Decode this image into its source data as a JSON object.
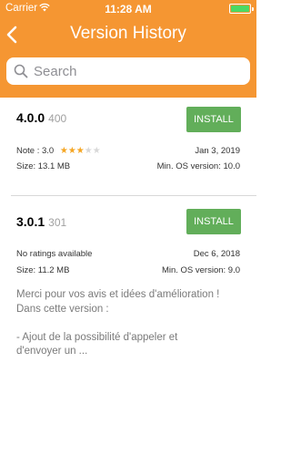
{
  "status": {
    "carrier": "Carrier",
    "time": "11:28 AM"
  },
  "header": {
    "title": "Version History"
  },
  "search": {
    "placeholder": "Search"
  },
  "versions": [
    {
      "version": "4.0.0",
      "build": "400",
      "install_label": "INSTALL",
      "note_label": "Note : 3.0",
      "rating": 3,
      "max_rating": 5,
      "date": "Jan 3, 2019",
      "size": "Size: 13.1 MB",
      "min_os": "Min. OS version: 10.0"
    },
    {
      "version": "3.0.1",
      "build": "301",
      "install_label": "INSTALL",
      "note_label": "No ratings available",
      "date": "Dec 6, 2018",
      "size": "Size: 11.2 MB",
      "min_os": "Min. OS version: 9.0",
      "release_notes": "Merci pour vos avis et idées d'amélioration !\nDans cette version :\n\n- Ajout de la possibilité d'appeler et\nd'envoyer un ..."
    }
  ],
  "colors": {
    "accent": "#F59632",
    "install": "#62AE5A",
    "star_on": "#F5A623",
    "star_off": "#D8D8D8"
  }
}
